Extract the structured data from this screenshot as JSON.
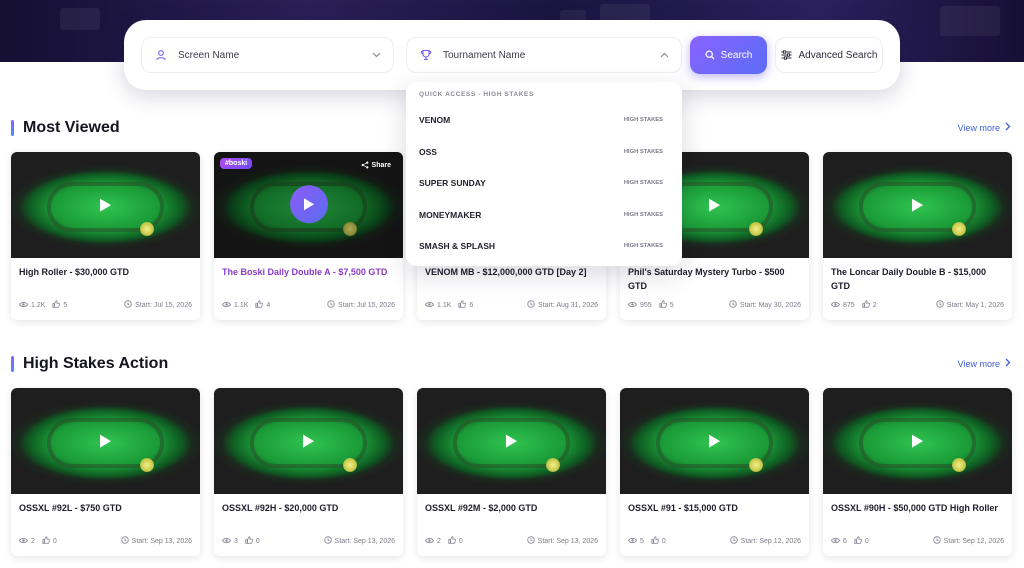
{
  "search": {
    "screen_name_label": "Screen Name",
    "tournament_name_label": "Tournament Name",
    "search_button": "Search",
    "advanced_search_button": "Advanced Search"
  },
  "dropdown": {
    "header": "QUICK ACCESS · HIGH STAKES",
    "items": [
      {
        "name": "VENOM",
        "tag": "HIGH STAKES"
      },
      {
        "name": "OSS",
        "tag": "HIGH STAKES"
      },
      {
        "name": "SUPER SUNDAY",
        "tag": "HIGH STAKES"
      },
      {
        "name": "MONEYMAKER",
        "tag": "HIGH STAKES"
      },
      {
        "name": "SMASH & SPLASH",
        "tag": "HIGH STAKES"
      }
    ]
  },
  "sections": [
    {
      "title": "Most Viewed",
      "view_more": "View more",
      "cards": [
        {
          "title": "High Roller - $30,000 GTD",
          "views": "1.2K",
          "likes": "5",
          "start": "Start: Jul 15, 2026"
        },
        {
          "title": "The Boski Daily Double A - $7,500 GTD",
          "views": "1.1K",
          "likes": "4",
          "start": "Start: Jul 15, 2026",
          "badge": "#boski",
          "share": "Share"
        },
        {
          "title": "VENOM MB - $12,000,000 GTD [Day 2]",
          "views": "1.1K",
          "likes": "6",
          "start": "Start: Aug 31, 2026"
        },
        {
          "title": "Phil's Saturday Mystery Turbo - $500 GTD",
          "views": "955",
          "likes": "5",
          "start": "Start: May 30, 2026"
        },
        {
          "title": "The Loncar Daily Double B - $15,000 GTD",
          "views": "875",
          "likes": "2",
          "start": "Start: May 1, 2026"
        }
      ]
    },
    {
      "title": "High Stakes Action",
      "view_more": "View more",
      "cards": [
        {
          "title": "OSSXL #92L - $750 GTD",
          "views": "2",
          "likes": "0",
          "start": "Start: Sep 13, 2026"
        },
        {
          "title": "OSSXL #92H - $20,000 GTD",
          "views": "3",
          "likes": "0",
          "start": "Start: Sep 13, 2026"
        },
        {
          "title": "OSSXL #92M - $2,000 GTD",
          "views": "2",
          "likes": "0",
          "start": "Start: Sep 13, 2026"
        },
        {
          "title": "OSSXL #91 - $15,000 GTD",
          "views": "5",
          "likes": "0",
          "start": "Start: Sep 12, 2026"
        },
        {
          "title": "OSSXL #90H - $50,000 GTD High Roller",
          "views": "6",
          "likes": "0",
          "start": "Start: Sep 12, 2026"
        }
      ]
    }
  ],
  "colors": {
    "accent": "#7a5cf7",
    "highlight_title": "#8b3bc4",
    "link": "#3f5fd8"
  }
}
